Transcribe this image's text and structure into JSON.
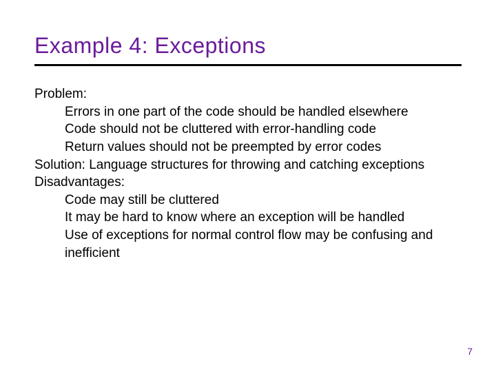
{
  "slide": {
    "title": "Example 4:  Exceptions",
    "page_number": "7",
    "body": {
      "problem_label": "Problem:",
      "problem_items": [
        "Errors in one part of the code should be handled elsewhere",
        "Code should not be cluttered with error-handling code",
        "Return values should not be preempted by error codes"
      ],
      "solution_line": "Solution:  Language structures for throwing and catching exceptions",
      "disadvantages_label": "Disadvantages:",
      "disadvantages_items": [
        "Code may still be cluttered",
        "It may be hard to know where an exception will be handled",
        "Use of exceptions for normal control flow may be confusing and inefficient"
      ]
    }
  }
}
